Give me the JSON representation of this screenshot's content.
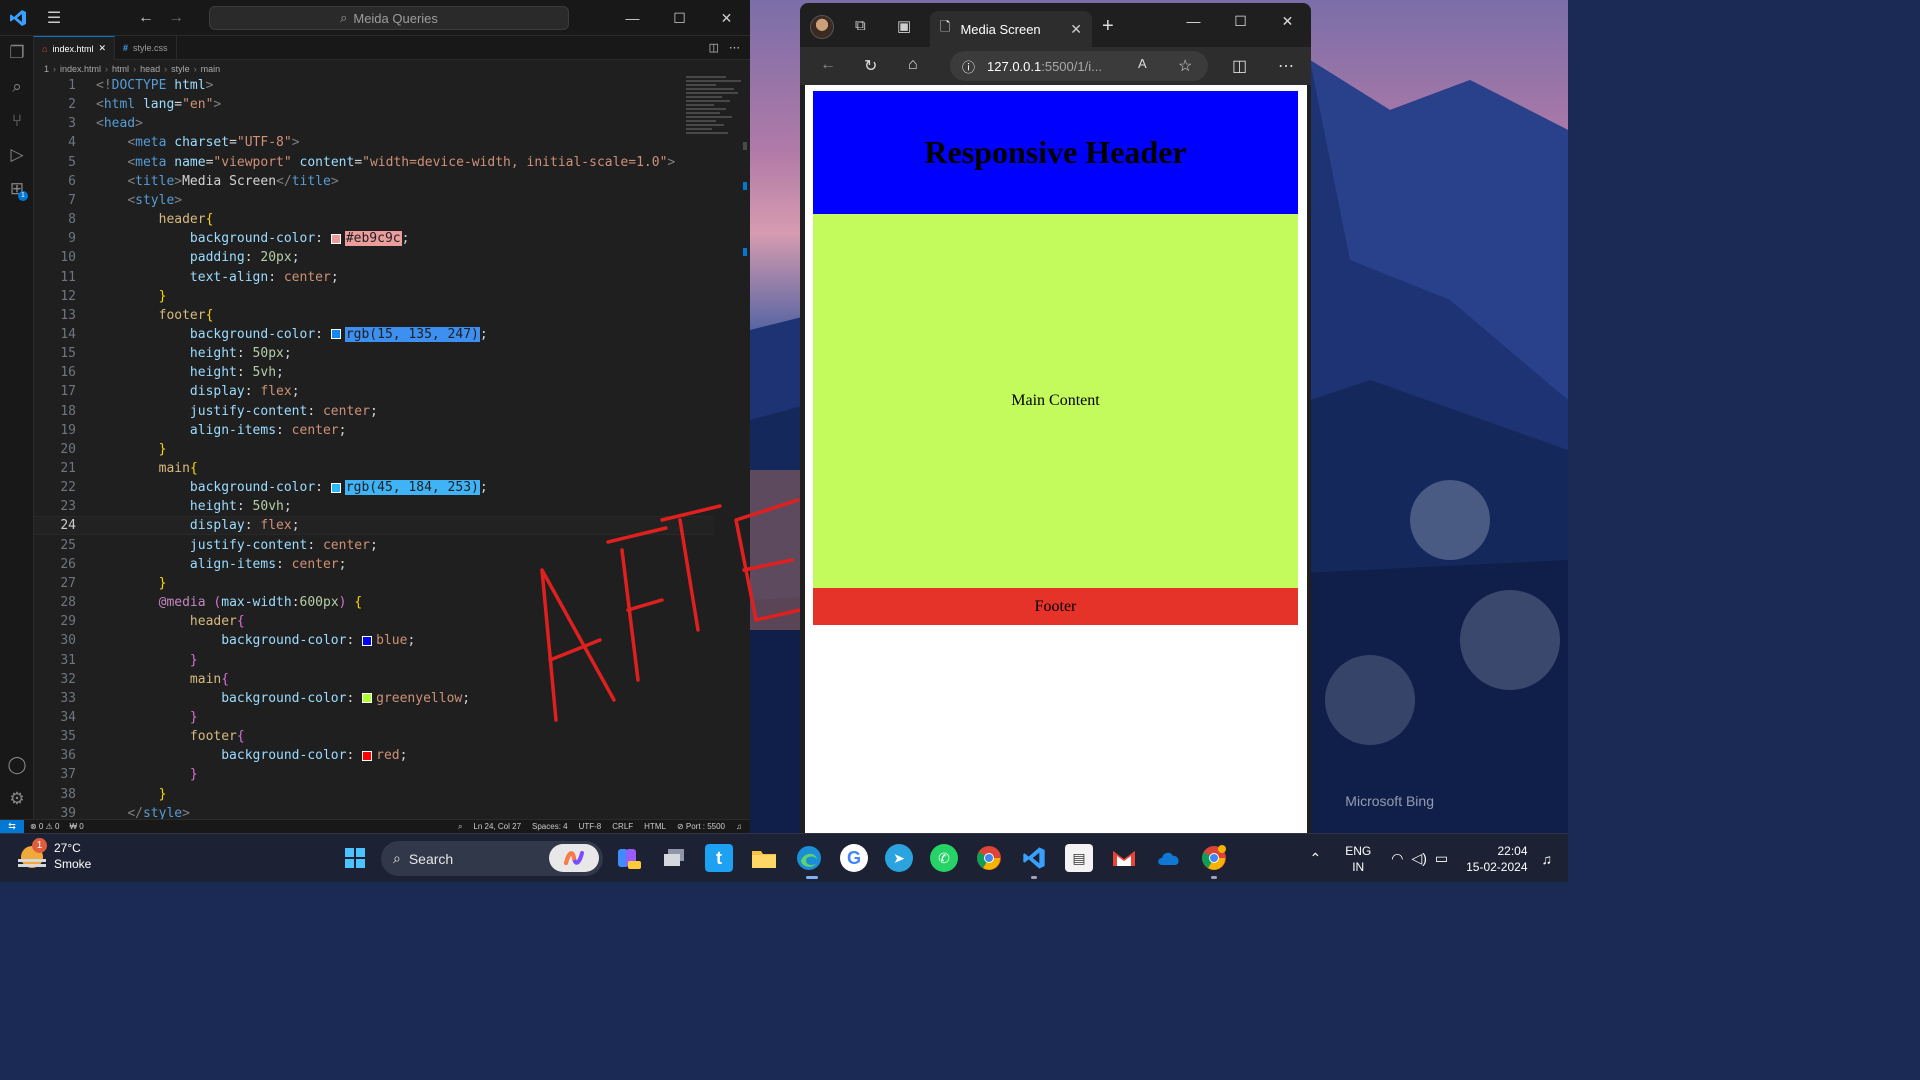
{
  "vscode": {
    "search_text": "Meida Queries",
    "tabs": [
      {
        "label": "index.html",
        "active": true
      },
      {
        "label": "style.css",
        "active": false
      }
    ],
    "breadcrumb": [
      "1",
      "index.html",
      "html",
      "head",
      "style",
      "main"
    ],
    "status": {
      "problems": "⊗ 0 ⚠ 0",
      "ports": "₩ 0",
      "position": "Ln 24, Col 27",
      "spaces": "Spaces: 4",
      "encoding": "UTF-8",
      "eol": "CRLF",
      "language": "HTML",
      "port": "⊘ Port : 5500"
    },
    "code_lines": [
      {
        "n": "1",
        "parts": [
          [
            "b",
            "<!"
          ],
          [
            "t",
            "DOCTYPE"
          ],
          [
            "x",
            " "
          ],
          [
            "a",
            "html"
          ],
          [
            "b",
            ">"
          ]
        ]
      },
      {
        "n": "2",
        "parts": [
          [
            "b",
            "<"
          ],
          [
            "t",
            "html"
          ],
          [
            "x",
            " "
          ],
          [
            "a",
            "lang"
          ],
          [
            "x",
            "="
          ],
          [
            "s",
            "\"en\""
          ],
          [
            "b",
            ">"
          ]
        ]
      },
      {
        "n": "3",
        "parts": [
          [
            "b",
            "<"
          ],
          [
            "t",
            "head"
          ],
          [
            "b",
            ">"
          ]
        ]
      },
      {
        "n": "4",
        "parts": [
          [
            "x",
            "    "
          ],
          [
            "b",
            "<"
          ],
          [
            "t",
            "meta"
          ],
          [
            "x",
            " "
          ],
          [
            "a",
            "charset"
          ],
          [
            "x",
            "="
          ],
          [
            "s",
            "\"UTF-8\""
          ],
          [
            "b",
            ">"
          ]
        ]
      },
      {
        "n": "5",
        "parts": [
          [
            "x",
            "    "
          ],
          [
            "b",
            "<"
          ],
          [
            "t",
            "meta"
          ],
          [
            "x",
            " "
          ],
          [
            "a",
            "name"
          ],
          [
            "x",
            "="
          ],
          [
            "s",
            "\"viewport\""
          ],
          [
            "x",
            " "
          ],
          [
            "a",
            "content"
          ],
          [
            "x",
            "="
          ],
          [
            "s",
            "\"width=device-width, initial-scale=1.0\""
          ],
          [
            "b",
            ">"
          ]
        ]
      },
      {
        "n": "6",
        "parts": [
          [
            "x",
            "    "
          ],
          [
            "b",
            "<"
          ],
          [
            "t",
            "title"
          ],
          [
            "b",
            ">"
          ],
          [
            "x",
            "Media Screen"
          ],
          [
            "b",
            "</"
          ],
          [
            "t",
            "title"
          ],
          [
            "b",
            ">"
          ]
        ]
      },
      {
        "n": "7",
        "parts": [
          [
            "x",
            "    "
          ],
          [
            "b",
            "<"
          ],
          [
            "t",
            "style"
          ],
          [
            "b",
            ">"
          ]
        ]
      },
      {
        "n": "8",
        "parts": [
          [
            "x",
            "        "
          ],
          [
            "sel",
            "header"
          ],
          [
            "br",
            "{"
          ]
        ]
      },
      {
        "n": "9",
        "parts": [
          [
            "x",
            "            "
          ],
          [
            "p",
            "background-color"
          ],
          [
            "x",
            ": "
          ],
          [
            "sw",
            "#eb9c9c"
          ],
          [
            "hl",
            "#eb9c9c"
          ],
          [
            "x",
            ";"
          ]
        ]
      },
      {
        "n": "10",
        "parts": [
          [
            "x",
            "            "
          ],
          [
            "p",
            "padding"
          ],
          [
            "x",
            ": "
          ],
          [
            "num",
            "20px"
          ],
          [
            "x",
            ";"
          ]
        ]
      },
      {
        "n": "11",
        "parts": [
          [
            "x",
            "            "
          ],
          [
            "p",
            "text-align"
          ],
          [
            "x",
            ": "
          ],
          [
            "v",
            "center"
          ],
          [
            "x",
            ";"
          ]
        ]
      },
      {
        "n": "12",
        "parts": [
          [
            "x",
            "        "
          ],
          [
            "br",
            "}"
          ]
        ]
      },
      {
        "n": "13",
        "parts": [
          [
            "x",
            "        "
          ],
          [
            "sel",
            "footer"
          ],
          [
            "br",
            "{"
          ]
        ]
      },
      {
        "n": "14",
        "parts": [
          [
            "x",
            "            "
          ],
          [
            "p",
            "background-color"
          ],
          [
            "x",
            ": "
          ],
          [
            "sw",
            "#0f87f7"
          ],
          [
            "hl",
            "rgb(15, 135, 247)"
          ],
          [
            "x",
            ";"
          ]
        ]
      },
      {
        "n": "15",
        "parts": [
          [
            "x",
            "            "
          ],
          [
            "p",
            "height"
          ],
          [
            "x",
            ": "
          ],
          [
            "num",
            "50px"
          ],
          [
            "x",
            ";"
          ]
        ]
      },
      {
        "n": "16",
        "parts": [
          [
            "x",
            "            "
          ],
          [
            "p",
            "height"
          ],
          [
            "x",
            ": "
          ],
          [
            "num",
            "5vh"
          ],
          [
            "x",
            ";"
          ]
        ]
      },
      {
        "n": "17",
        "parts": [
          [
            "x",
            "            "
          ],
          [
            "p",
            "display"
          ],
          [
            "x",
            ": "
          ],
          [
            "v",
            "flex"
          ],
          [
            "x",
            ";"
          ]
        ]
      },
      {
        "n": "18",
        "parts": [
          [
            "x",
            "            "
          ],
          [
            "p",
            "justify-content"
          ],
          [
            "x",
            ": "
          ],
          [
            "v",
            "center"
          ],
          [
            "x",
            ";"
          ]
        ]
      },
      {
        "n": "19",
        "parts": [
          [
            "x",
            "            "
          ],
          [
            "p",
            "align-items"
          ],
          [
            "x",
            ": "
          ],
          [
            "v",
            "center"
          ],
          [
            "x",
            ";"
          ]
        ]
      },
      {
        "n": "20",
        "parts": [
          [
            "x",
            "        "
          ],
          [
            "br",
            "}"
          ]
        ]
      },
      {
        "n": "21",
        "parts": [
          [
            "x",
            "        "
          ],
          [
            "sel",
            "main"
          ],
          [
            "br",
            "{"
          ]
        ]
      },
      {
        "n": "22",
        "parts": [
          [
            "x",
            "            "
          ],
          [
            "p",
            "background-color"
          ],
          [
            "x",
            ": "
          ],
          [
            "sw",
            "#2db8fd"
          ],
          [
            "hl",
            "rgb(45, 184, 253)"
          ],
          [
            "x",
            ";"
          ]
        ]
      },
      {
        "n": "23",
        "parts": [
          [
            "x",
            "            "
          ],
          [
            "p",
            "height"
          ],
          [
            "x",
            ": "
          ],
          [
            "num",
            "50vh"
          ],
          [
            "x",
            ";"
          ]
        ]
      },
      {
        "n": "24",
        "parts": [
          [
            "x",
            "            "
          ],
          [
            "p",
            "display"
          ],
          [
            "x",
            ": "
          ],
          [
            "v",
            "flex"
          ],
          [
            "x",
            ";"
          ]
        ],
        "current": true
      },
      {
        "n": "25",
        "parts": [
          [
            "x",
            "            "
          ],
          [
            "p",
            "justify-content"
          ],
          [
            "x",
            ": "
          ],
          [
            "v",
            "center"
          ],
          [
            "x",
            ";"
          ]
        ]
      },
      {
        "n": "26",
        "parts": [
          [
            "x",
            "            "
          ],
          [
            "p",
            "align-items"
          ],
          [
            "x",
            ": "
          ],
          [
            "v",
            "center"
          ],
          [
            "x",
            ";"
          ]
        ]
      },
      {
        "n": "27",
        "parts": [
          [
            "x",
            "        "
          ],
          [
            "br",
            "}"
          ]
        ]
      },
      {
        "n": "28",
        "parts": [
          [
            "x",
            "        "
          ],
          [
            "at",
            "@media"
          ],
          [
            "x",
            " "
          ],
          [
            "br2",
            "("
          ],
          [
            "p",
            "max-width"
          ],
          [
            "x",
            ":"
          ],
          [
            "num",
            "600px"
          ],
          [
            "br2",
            ")"
          ],
          [
            "x",
            " "
          ],
          [
            "br",
            "{"
          ]
        ]
      },
      {
        "n": "29",
        "parts": [
          [
            "x",
            "            "
          ],
          [
            "sel",
            "header"
          ],
          [
            "br2",
            "{"
          ]
        ]
      },
      {
        "n": "30",
        "parts": [
          [
            "x",
            "                "
          ],
          [
            "p",
            "background-color"
          ],
          [
            "x",
            ": "
          ],
          [
            "sw",
            "#0000ff"
          ],
          [
            "v",
            "blue"
          ],
          [
            "x",
            ";"
          ]
        ]
      },
      {
        "n": "31",
        "parts": [
          [
            "x",
            "            "
          ],
          [
            "br2",
            "}"
          ]
        ]
      },
      {
        "n": "32",
        "parts": [
          [
            "x",
            "            "
          ],
          [
            "sel",
            "main"
          ],
          [
            "br2",
            "{"
          ]
        ]
      },
      {
        "n": "33",
        "parts": [
          [
            "x",
            "                "
          ],
          [
            "p",
            "background-color"
          ],
          [
            "x",
            ": "
          ],
          [
            "sw",
            "#adff2f"
          ],
          [
            "v",
            "greenyellow"
          ],
          [
            "x",
            ";"
          ]
        ]
      },
      {
        "n": "34",
        "parts": [
          [
            "x",
            "            "
          ],
          [
            "br2",
            "}"
          ]
        ]
      },
      {
        "n": "35",
        "parts": [
          [
            "x",
            "            "
          ],
          [
            "sel",
            "footer"
          ],
          [
            "br2",
            "{"
          ]
        ]
      },
      {
        "n": "36",
        "parts": [
          [
            "x",
            "                "
          ],
          [
            "p",
            "background-color"
          ],
          [
            "x",
            ": "
          ],
          [
            "sw",
            "#ff0000"
          ],
          [
            "v",
            "red"
          ],
          [
            "x",
            ";"
          ]
        ]
      },
      {
        "n": "37",
        "parts": [
          [
            "x",
            "            "
          ],
          [
            "br2",
            "}"
          ]
        ]
      },
      {
        "n": "38",
        "parts": [
          [
            "x",
            "        "
          ],
          [
            "br",
            "}"
          ]
        ]
      },
      {
        "n": "39",
        "parts": [
          [
            "x",
            "    "
          ],
          [
            "b",
            "</"
          ],
          [
            "t",
            "style"
          ],
          [
            "b",
            ">"
          ]
        ]
      }
    ]
  },
  "annotation": {
    "text": "AFTER",
    "color": "#e0201f"
  },
  "browser": {
    "tab_title": "Media Screen",
    "address": "127.0.0.1",
    "address_rest": ":5500/1/i...",
    "page": {
      "header_text": "Responsive Header",
      "main_text": "Main Content",
      "footer_text": "Footer",
      "header_color": "#0000ff",
      "main_color": "#c4fb5c",
      "footer_color": "#e5332a"
    }
  },
  "desktop": {
    "watermark": "Microsoft Bing"
  },
  "taskbar": {
    "weather_temp": "27°C",
    "weather_desc": "Smoke",
    "weather_badge": "1",
    "search_label": "Search",
    "lang_top": "ENG",
    "lang_bottom": "IN",
    "time": "22:04",
    "date": "15-02-2024"
  },
  "colors": {
    "accent": "#0078d4",
    "editor_bg": "#1f1f1f"
  }
}
